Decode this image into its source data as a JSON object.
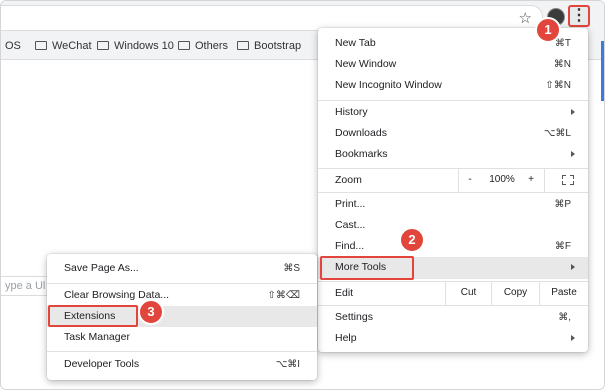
{
  "toolbar": {
    "star_icon": "star-icon",
    "avatar_icon": "profile-avatar-icon",
    "menu_icon": "three-dots-menu-icon",
    "menu_glyph": "⋮"
  },
  "bookmarks": [
    {
      "label": "OS"
    },
    {
      "label": "WeChat"
    },
    {
      "label": "Windows 10"
    },
    {
      "label": "Others"
    },
    {
      "label": "Bootstrap"
    }
  ],
  "page": {
    "url_placeholder_fragment": "ype a Ul"
  },
  "main_menu": {
    "new_tab": {
      "label": "New Tab",
      "shortcut": "⌘T"
    },
    "new_window": {
      "label": "New Window",
      "shortcut": "⌘N"
    },
    "new_incognito": {
      "label": "New Incognito Window",
      "shortcut": "⇧⌘N"
    },
    "history": {
      "label": "History"
    },
    "downloads": {
      "label": "Downloads",
      "shortcut": "⌥⌘L"
    },
    "bookmarks": {
      "label": "Bookmarks"
    },
    "zoom": {
      "label": "Zoom",
      "minus": "-",
      "value": "100%",
      "plus": "+"
    },
    "print": {
      "label": "Print...",
      "shortcut": "⌘P"
    },
    "cast": {
      "label": "Cast..."
    },
    "find": {
      "label": "Find...",
      "shortcut": "⌘F"
    },
    "more_tools": {
      "label": "More Tools"
    },
    "edit": {
      "label": "Edit",
      "cut": "Cut",
      "copy": "Copy",
      "paste": "Paste"
    },
    "settings": {
      "label": "Settings",
      "shortcut": "⌘,"
    },
    "help": {
      "label": "Help"
    }
  },
  "sub_menu": {
    "save_page": {
      "label": "Save Page As...",
      "shortcut": "⌘S"
    },
    "clear_browsing": {
      "label": "Clear Browsing Data...",
      "shortcut": "⇧⌘⌫"
    },
    "extensions": {
      "label": "Extensions"
    },
    "task_manager": {
      "label": "Task Manager"
    },
    "developer_tools": {
      "label": "Developer Tools",
      "shortcut": "⌥⌘I"
    }
  },
  "badges": {
    "one": "1",
    "two": "2",
    "three": "3"
  },
  "colors": {
    "annotation_red": "#e2453c",
    "highlight": "#e8e8e8"
  }
}
